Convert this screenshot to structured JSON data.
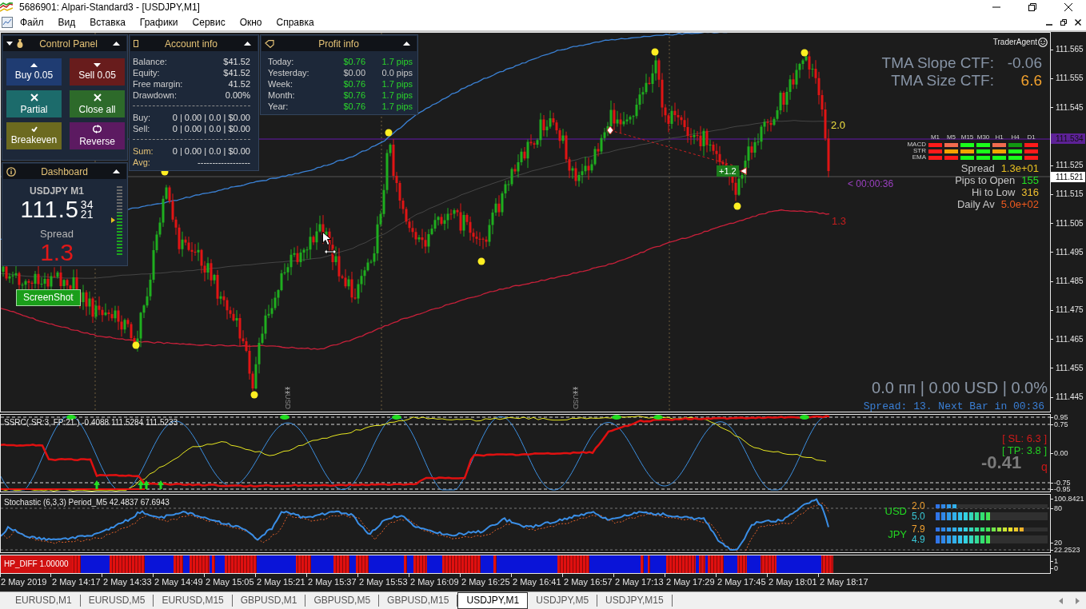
{
  "window": {
    "title": "5686901: Alpari-Standard3 - [USDJPY,M1]"
  },
  "menu": [
    "Файл",
    "Вид",
    "Вставка",
    "Графики",
    "Сервис",
    "Окно",
    "Справка"
  ],
  "chart": {
    "control_panel": {
      "title": "Control Panel",
      "buttons": [
        {
          "kind": "buy",
          "label": "Buy 0.05"
        },
        {
          "kind": "sell",
          "label": "Sell 0.05"
        },
        {
          "kind": "partial",
          "label": "Partial"
        },
        {
          "kind": "close",
          "label": "Close all"
        },
        {
          "kind": "breakeven",
          "label": "Breakeven"
        },
        {
          "kind": "reverse",
          "label": "Reverse"
        }
      ]
    },
    "account_info": {
      "title": "Account info",
      "rows": [
        {
          "label": "Balance:",
          "value": "$41.52"
        },
        {
          "label": "Equity:",
          "value": "$41.52"
        },
        {
          "label": "Free margin:",
          "value": "41.52"
        },
        {
          "label": "Drawdown:",
          "value": "0.00%"
        }
      ],
      "positions": [
        {
          "label": "Buy:",
          "value": "0 | 0.00 | 0.0 | $0.00"
        },
        {
          "label": "Sell:",
          "value": "0 | 0.00 | 0.0 | $0.00"
        }
      ],
      "totals": [
        {
          "label": "Sum:",
          "value": "0 | 0.00 | 0.0 | $0.00"
        },
        {
          "label": "Avg:",
          "value": "------------------"
        }
      ]
    },
    "profit_info": {
      "title": "Profit info",
      "rows": [
        {
          "label": "Today:",
          "amount": "$0.76",
          "pips": "1.7 pips",
          "color": "#2bd62b"
        },
        {
          "label": "Yesterday:",
          "amount": "$0.00",
          "pips": "0.0 pips",
          "color": "#c8c8c8"
        },
        {
          "label": "Week:",
          "amount": "$0.76",
          "pips": "1.7 pips",
          "color": "#2bd62b"
        },
        {
          "label": "Month:",
          "amount": "$0.76",
          "pips": "1.7 pips",
          "color": "#2bd62b"
        },
        {
          "label": "Year:",
          "amount": "$0.76",
          "pips": "1.7 pips",
          "color": "#2bd62b"
        }
      ]
    },
    "dashboard": {
      "title": "Dashboard",
      "symbol": "USDJPY M1",
      "price": "111.5",
      "price_digits": [
        "34",
        "21"
      ],
      "level": 0.6,
      "spread_label": "Spread",
      "spread": "1.3"
    },
    "screenshot_button": "ScreenShot",
    "brand": "TraderAgent",
    "tma": [
      {
        "label": "TMA Slope CTF:",
        "value": "-0.06",
        "color": "#8794a6"
      },
      {
        "label": "TMA Size CTF:",
        "value": "6.6",
        "color": "#f2a22e"
      }
    ],
    "band_labels": [
      {
        "kind": "upper",
        "text": "2.0",
        "color": "#f0e040"
      },
      {
        "kind": "lower",
        "text": "1.3",
        "color": "#c41e1e"
      }
    ],
    "signal_grid": {
      "columns": [
        "M1",
        "M5",
        "M15",
        "M30",
        "H1",
        "H4",
        "D1"
      ],
      "rows": [
        {
          "label": "MACD",
          "cells": [
            {
              "color": "#ff1a1a"
            },
            {
              "color": "#f26b4f"
            },
            {
              "color": "#1aff1a"
            },
            {
              "color": "#1aff1a"
            },
            {
              "color": "#f26b4f"
            },
            {
              "color": "#119911"
            },
            {
              "color": "#ff1a1a"
            }
          ]
        },
        {
          "label": "STR",
          "cells": [
            {
              "color": "#ff1a1a"
            },
            {
              "color": "#f5a300"
            },
            {
              "color": "#f5a300"
            },
            {
              "color": "#1aff1a"
            },
            {
              "color": "#f5a300"
            },
            {
              "color": "#1aff1a"
            },
            {
              "color": "#ff1a1a"
            }
          ]
        },
        {
          "label": "EMA",
          "cells": [
            {
              "color": "#ff1a1a"
            },
            {
              "color": "#ff1a1a"
            },
            {
              "color": "#1aff1a"
            },
            {
              "color": "#1aff1a"
            },
            {
              "color": "#1aff1a"
            },
            {
              "color": "#1aff1a"
            },
            {
              "color": "#ff1a1a"
            }
          ]
        }
      ]
    },
    "stats": [
      {
        "label": "Spread",
        "value": "1.3e+01",
        "color": "#e8c020"
      },
      {
        "label": "Pips to Open",
        "value": "155",
        "color": "#22e022"
      },
      {
        "label": "Hi to Low",
        "value": "316",
        "color": "#f0c030"
      },
      {
        "label": "Daily Av",
        "value": "5.0e+02",
        "color": "#f05a1e"
      }
    ],
    "bar_timer": "< 00:00:36",
    "trade_label": "+1.2",
    "event_markers": [
      "USD",
      "USD"
    ],
    "summary": "0.0 пп | 0.00 USD | 0.0%",
    "next_bar": "Spread: 13. Next Bar in 00:36",
    "price_axis": [
      "111.565",
      "111.555",
      "111.545",
      "111.525",
      "111.515",
      "111.505",
      "111.495",
      "111.485",
      "111.475",
      "111.465",
      "111.455",
      "111.445"
    ],
    "price_markers": [
      {
        "kind": "line",
        "label": "111.534"
      },
      {
        "kind": "current",
        "label": "111.521"
      }
    ]
  },
  "ssrc_pane": {
    "title": "SSRC( SR:3, FP:21 ) -0.4088 111.5284 111.5233",
    "axis": [
      "0.95",
      "0.75",
      "0.00",
      "-0.75",
      "-0.95"
    ],
    "stop_loss": "[ SL: 6.3 ]",
    "take_profit": "[ TP: 3.8 ]",
    "value": "-0.41",
    "signal": "q"
  },
  "stochastic_pane": {
    "title": "Stochastic (6,3,3) Period_M5 42.4837 67.6943",
    "axis": [
      "100.8421",
      "80",
      "20",
      "22.2523"
    ],
    "currencies": [
      {
        "name": "USD",
        "meters": [
          {
            "kind": "thin",
            "reading": "2.0",
            "level": 0.2
          },
          {
            "kind": "thick",
            "reading": "5.0",
            "level": 0.5
          }
        ]
      },
      {
        "name": "JPY",
        "meters": [
          {
            "kind": "thin",
            "reading": "7.9",
            "level": 0.79
          },
          {
            "kind": "thick",
            "reading": "4.9",
            "level": 0.49
          }
        ]
      }
    ]
  },
  "hp_pane": {
    "title": "HP_DIFF 1.00000",
    "axis": [
      "1",
      "0"
    ]
  },
  "time_axis": [
    "2 May 2019",
    "2 May 14:17",
    "2 May 14:33",
    "2 May 14:49",
    "2 May 15:05",
    "2 May 15:21",
    "2 May 15:37",
    "2 May 15:53",
    "2 May 16:09",
    "2 May 16:25",
    "2 May 16:41",
    "2 May 16:57",
    "2 May 17:13",
    "2 May 17:29",
    "2 May 17:45",
    "2 May 18:01",
    "2 May 18:17"
  ],
  "tabs": [
    {
      "label": "EURUSD,M1",
      "selected": false
    },
    {
      "label": "EURUSD,M5",
      "selected": false
    },
    {
      "label": "EURUSD,M15",
      "selected": false
    },
    {
      "label": "GBPUSD,M1",
      "selected": false
    },
    {
      "label": "GBPUSD,M5",
      "selected": false
    },
    {
      "label": "GBPUSD,M15",
      "selected": false
    },
    {
      "label": "USDJPY,M1",
      "selected": true
    },
    {
      "label": "USDJPY,M5",
      "selected": false
    },
    {
      "label": "USDJPY,M15",
      "selected": false
    }
  ]
}
